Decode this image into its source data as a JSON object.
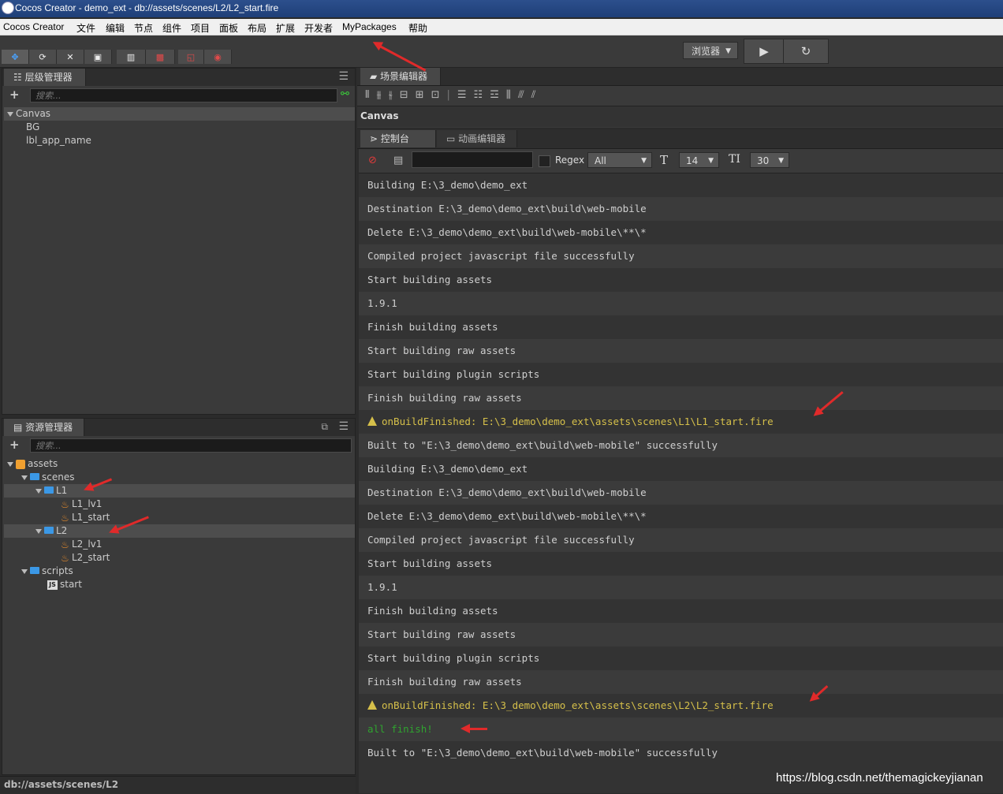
{
  "window": {
    "title": "Cocos Creator - demo_ext - db://assets/scenes/L2/L2_start.fire"
  },
  "menu": [
    "Cocos Creator",
    "文件",
    "编辑",
    "节点",
    "组件",
    "项目",
    "面板",
    "布局",
    "扩展",
    "开发者",
    "MyPackages",
    "帮助"
  ],
  "toolbar": {
    "browser_label": "浏览器",
    "play_icon": "▶",
    "refresh_icon": "↻"
  },
  "hierarchy": {
    "tab_label": "层级管理器",
    "search_placeholder": "搜索...",
    "root": "Canvas",
    "children": [
      "BG",
      "lbl_app_name"
    ]
  },
  "assets": {
    "tab_label": "资源管理器",
    "search_placeholder": "搜索...",
    "tree": {
      "root": "assets",
      "scenes": "scenes",
      "L1": "L1",
      "L1_items": [
        "L1_lv1",
        "L1_start"
      ],
      "L2": "L2",
      "L2_items": [
        "L2_lv1",
        "L2_start"
      ],
      "scripts": "scripts",
      "script_items": [
        "start"
      ]
    },
    "status_path": "db://assets/scenes/L2"
  },
  "scene_editor": {
    "tab_label": "场景编辑器",
    "node_label": "Canvas"
  },
  "console_tabs": {
    "console": "控制台",
    "animation": "动画编辑器"
  },
  "console_controls": {
    "regex_label": "Regex",
    "filter": "All",
    "font_size": "14",
    "line_height": "30"
  },
  "console_lines": [
    {
      "text": "Building E:\\3_demo\\demo_ext",
      "type": "log"
    },
    {
      "text": "Destination E:\\3_demo\\demo_ext\\build\\web-mobile",
      "type": "log"
    },
    {
      "text": "Delete E:\\3_demo\\demo_ext\\build\\web-mobile\\**\\*",
      "type": "log"
    },
    {
      "text": "Compiled project javascript file successfully",
      "type": "log"
    },
    {
      "text": "Start building assets",
      "type": "log"
    },
    {
      "text": "1.9.1",
      "type": "log"
    },
    {
      "text": "Finish building assets",
      "type": "log"
    },
    {
      "text": "Start building raw assets",
      "type": "log"
    },
    {
      "text": "Start building plugin scripts",
      "type": "log"
    },
    {
      "text": "Finish building raw assets",
      "type": "log"
    },
    {
      "text": "onBuildFinished: E:\\3_demo\\demo_ext\\assets\\scenes\\L1\\L1_start.fire",
      "type": "warn"
    },
    {
      "text": "Built to \"E:\\3_demo\\demo_ext\\build\\web-mobile\" successfully",
      "type": "log"
    },
    {
      "text": "Building E:\\3_demo\\demo_ext",
      "type": "log"
    },
    {
      "text": "Destination E:\\3_demo\\demo_ext\\build\\web-mobile",
      "type": "log"
    },
    {
      "text": "Delete E:\\3_demo\\demo_ext\\build\\web-mobile\\**\\*",
      "type": "log"
    },
    {
      "text": "Compiled project javascript file successfully",
      "type": "log"
    },
    {
      "text": "Start building assets",
      "type": "log"
    },
    {
      "text": "1.9.1",
      "type": "log"
    },
    {
      "text": "Finish building assets",
      "type": "log"
    },
    {
      "text": "Start building raw assets",
      "type": "log"
    },
    {
      "text": "Start building plugin scripts",
      "type": "log"
    },
    {
      "text": "Finish building raw assets",
      "type": "log"
    },
    {
      "text": "onBuildFinished: E:\\3_demo\\demo_ext\\assets\\scenes\\L2\\L2_start.fire",
      "type": "warn"
    },
    {
      "text": "all finish!",
      "type": "ok"
    },
    {
      "text": "Built to \"E:\\3_demo\\demo_ext\\build\\web-mobile\" successfully",
      "type": "log"
    }
  ],
  "watermark": "https://blog.csdn.net/themagickeyjianan"
}
